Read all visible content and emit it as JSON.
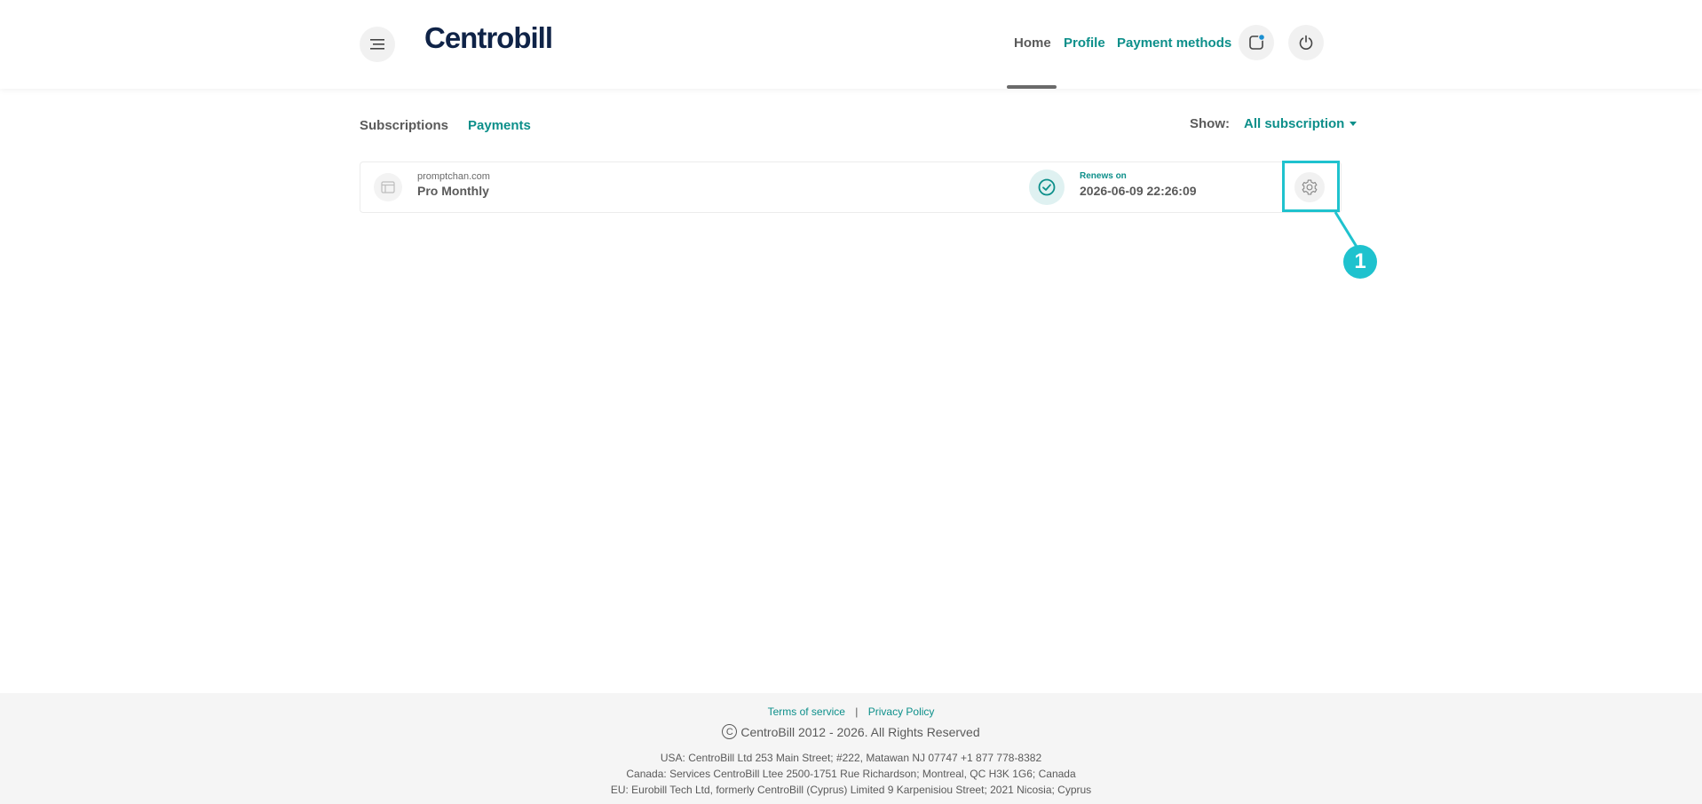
{
  "header": {
    "logo": "Centrobill",
    "nav": {
      "home": "Home",
      "profile": "Profile",
      "payment_methods": "Payment methods"
    },
    "icons": [
      "menu-icon",
      "notification-icon",
      "power-icon"
    ]
  },
  "tabs": {
    "subscriptions": "Subscriptions",
    "payments": "Payments"
  },
  "filter": {
    "label": "Show:",
    "selected": "All subscription"
  },
  "subscription": {
    "site": "promptchan.com",
    "plan": "Pro Monthly",
    "renews_label": "Renews on",
    "renews_date": "2026-06-09 22:26:09"
  },
  "annotation": {
    "number": "1",
    "color": "#1fc2ce"
  },
  "footer": {
    "terms": "Terms of service",
    "separator": "|",
    "privacy": "Privacy Policy",
    "copyright_symbol": "C",
    "copyright": "CentroBill 2012 - 2026. All Rights Reserved",
    "address_usa": "USA: CentroBill Ltd 253 Main Street; #222, Matawan NJ 07747 +1 877 778-8382",
    "address_canada": "Canada: Services CentroBill Ltee 2500-1751 Rue Richardson; Montreal, QC H3K 1G6; Canada",
    "address_eu": "EU: Eurobill Tech Ltd, formerly CentroBill (Cyprus) Limited 9 Karpenisiou Street; 2021 Nicosia; Cyprus"
  },
  "colors": {
    "accent": "#0c8f8a",
    "logo": "#0f2347",
    "annotation": "#1fc2ce"
  }
}
